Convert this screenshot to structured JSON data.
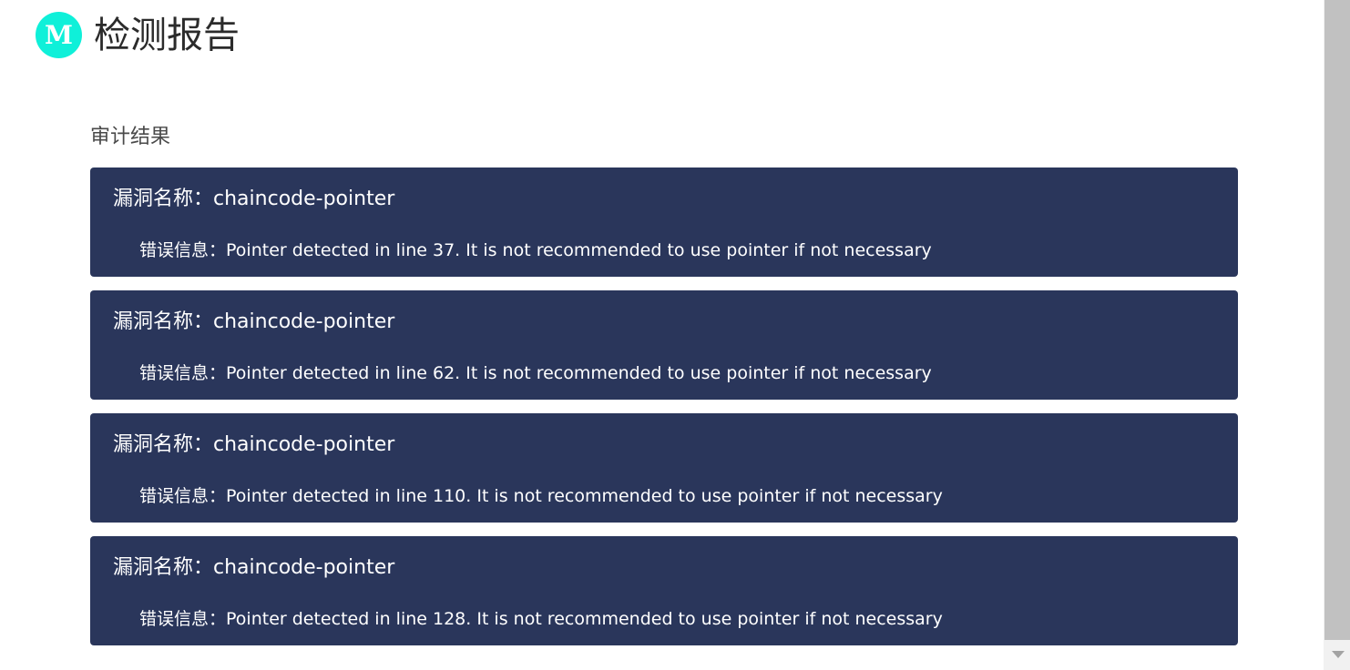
{
  "header": {
    "logo_letter": "M",
    "title": "检测报告"
  },
  "section": {
    "title": "审计结果"
  },
  "results": [
    {
      "vuln_label": "漏洞名称：",
      "vuln_name": "chaincode-pointer",
      "error_label": "错误信息：",
      "error_message": "Pointer detected in line 37. It is not recommended to use pointer if not necessary"
    },
    {
      "vuln_label": "漏洞名称：",
      "vuln_name": "chaincode-pointer",
      "error_label": "错误信息：",
      "error_message": "Pointer detected in line 62. It is not recommended to use pointer if not necessary"
    },
    {
      "vuln_label": "漏洞名称：",
      "vuln_name": "chaincode-pointer",
      "error_label": "错误信息：",
      "error_message": "Pointer detected in line 110. It is not recommended to use pointer if not necessary"
    },
    {
      "vuln_label": "漏洞名称：",
      "vuln_name": "chaincode-pointer",
      "error_label": "错误信息：",
      "error_message": "Pointer detected in line 128. It is not recommended to use pointer if not necessary"
    }
  ],
  "colors": {
    "logo_bg": "#0ff0d9",
    "card_bg": "#2a365b",
    "card_text": "#ffffff"
  }
}
